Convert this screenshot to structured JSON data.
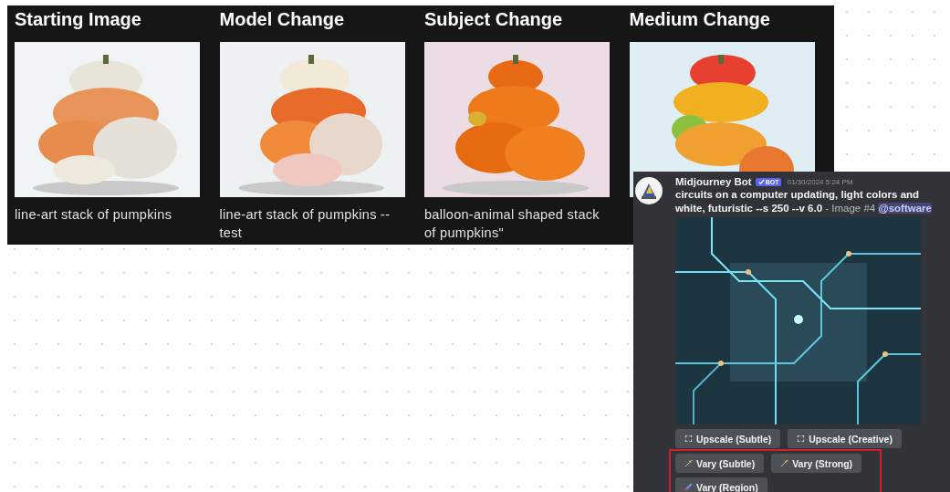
{
  "panel": {
    "columns": [
      {
        "title": "Starting Image",
        "caption": "line-art stack of pumpkins"
      },
      {
        "title": "Model Change",
        "caption": "line-art stack of pumpkins --test"
      },
      {
        "title": "Subject Change",
        "caption": "balloon-animal shaped stack of pumpkins\""
      },
      {
        "title": "Medium Change"
      }
    ]
  },
  "message": {
    "author": "Midjourney Bot",
    "badge": "BOT",
    "timestamp": "01/30/2024 5:24 PM",
    "prompt": "circuits on a computer updating, light colors and white, futuristic --s 250 --v 6.0",
    "suffix": "- Image #4",
    "mention": "@software",
    "button_rows": [
      {
        "buttons": [
          {
            "kind": "upscale",
            "label": "Upscale (Subtle)"
          },
          {
            "kind": "upscale",
            "label": "Upscale (Creative)"
          }
        ]
      }
    ],
    "highlighted_button_rows": [
      {
        "buttons": [
          {
            "kind": "vary",
            "label": "Vary (Subtle)"
          },
          {
            "kind": "vary",
            "label": "Vary (Strong)"
          }
        ]
      },
      {
        "buttons": [
          {
            "kind": "region",
            "label": "Vary (Region)"
          }
        ]
      }
    ]
  }
}
